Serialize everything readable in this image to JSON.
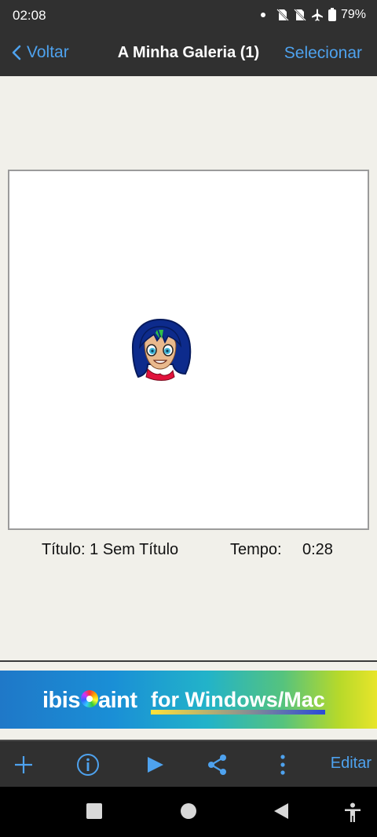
{
  "status_bar": {
    "time": "02:08",
    "battery": "79%",
    "icons": [
      "notification-dot-icon",
      "no-sim-icon",
      "no-sim-icon",
      "airplane-icon",
      "battery-icon"
    ]
  },
  "nav": {
    "back_label": "Voltar",
    "title": "A Minha Galeria (1)",
    "select_label": "Selecionar"
  },
  "artwork": {
    "title_text": "Título: 1 Sem Título",
    "time_label": "Tempo:",
    "time_value": "0:28"
  },
  "ad": {
    "brand_pre": "ibis",
    "brand_post": "aint",
    "tagline": "for Windows/Mac"
  },
  "toolbar": {
    "icons": [
      "add-icon",
      "info-icon",
      "play-icon",
      "share-icon",
      "more-vertical-icon"
    ],
    "edit_label": "Editar",
    "accent_color": "#4ea2ee"
  },
  "system_nav": {
    "icons": [
      "recents-square-icon",
      "home-circle-icon",
      "back-triangle-icon",
      "accessibility-icon"
    ]
  }
}
